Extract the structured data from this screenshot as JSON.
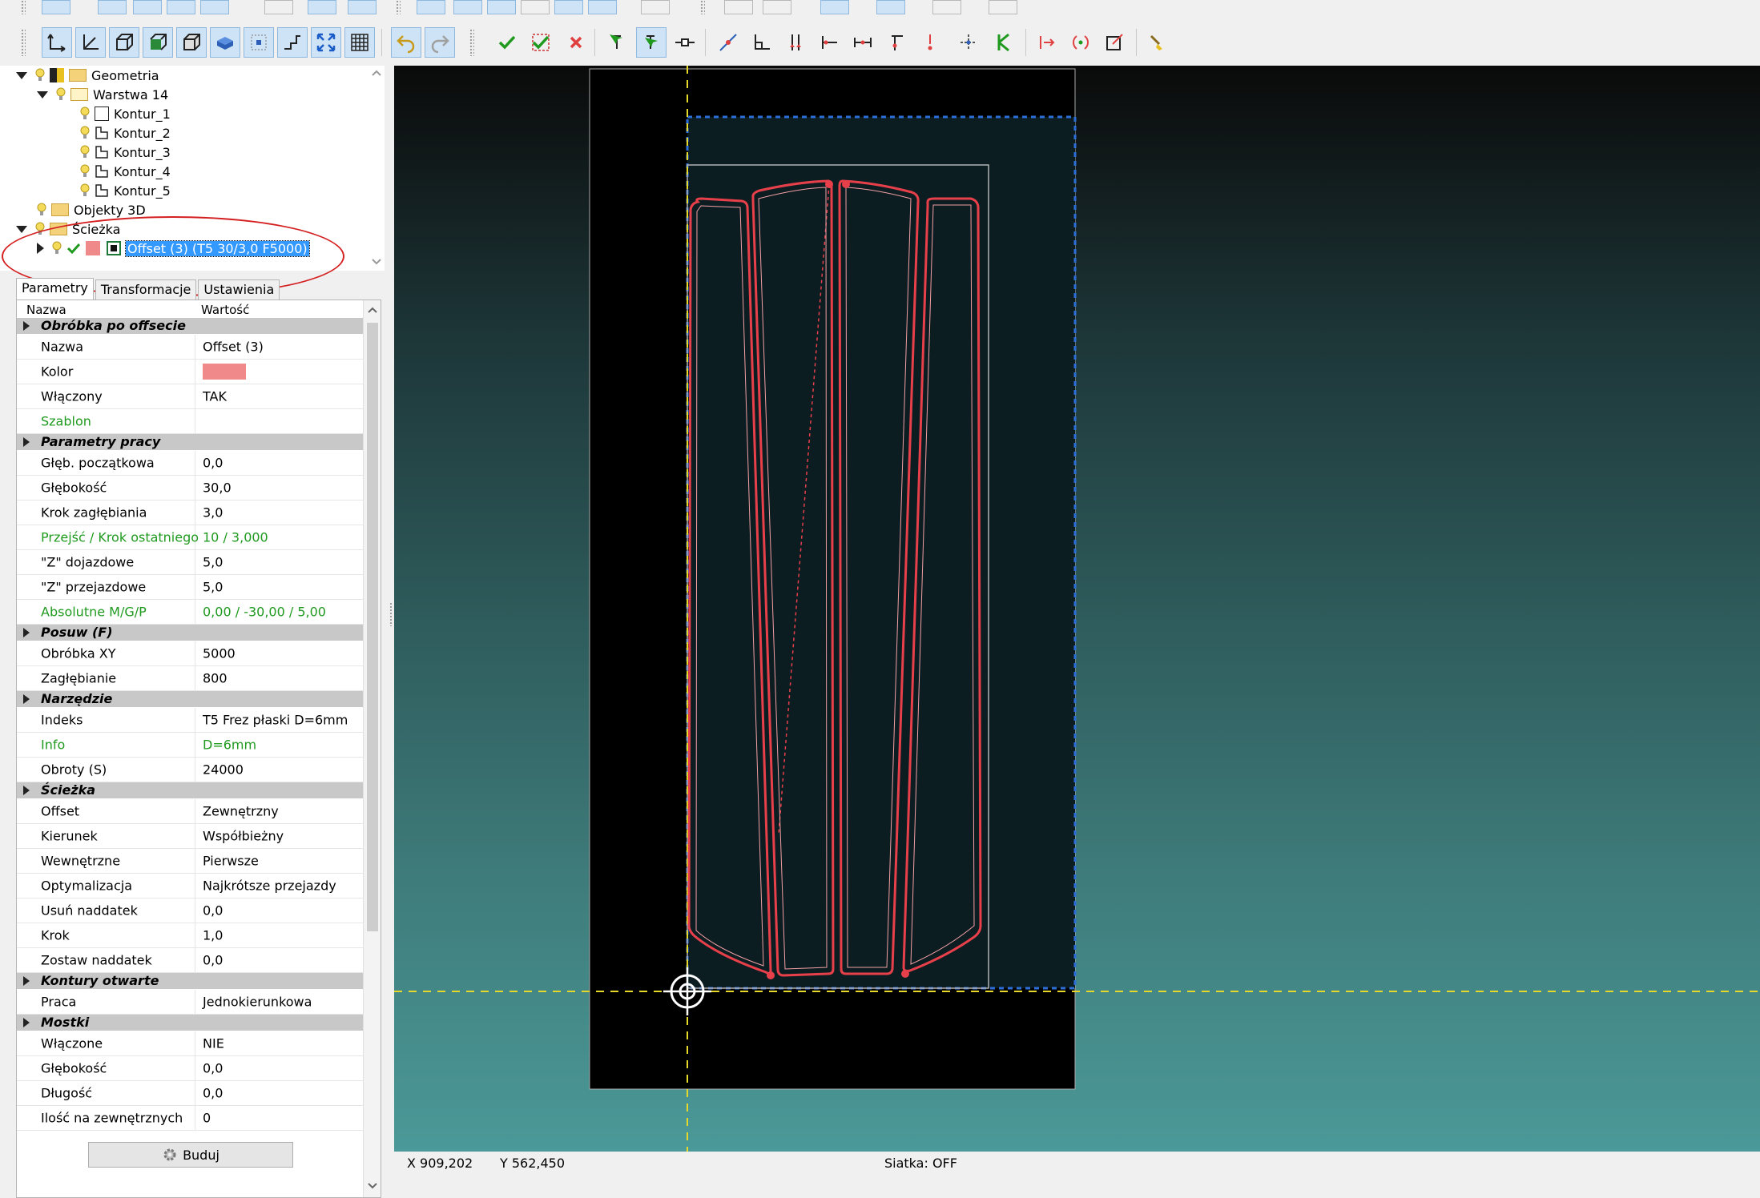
{
  "tree": {
    "items": [
      {
        "label": "Geometria"
      },
      {
        "label": "Warstwa 14"
      },
      {
        "label": "Kontur_1"
      },
      {
        "label": "Kontur_2"
      },
      {
        "label": "Kontur_3"
      },
      {
        "label": "Kontur_4"
      },
      {
        "label": "Kontur_5"
      },
      {
        "label": "Objekty 3D"
      },
      {
        "label": "Ścieżka"
      },
      {
        "label": "Offset (3) (T5 30/3,0 F5000)"
      }
    ]
  },
  "tabs": [
    "Parametry",
    "Transformacje",
    "Ustawienia"
  ],
  "grid": {
    "header": {
      "name": "Nazwa",
      "value": "Wartość"
    },
    "sections": [
      {
        "title": "Obróbka po offsecie",
        "rows": [
          {
            "name": "Nazwa",
            "value": "Offset (3)"
          },
          {
            "name": "Kolor",
            "value": "",
            "color": "#f08a8a"
          },
          {
            "name": "Włączony",
            "value": "TAK"
          },
          {
            "name": "Szablon",
            "value": "",
            "green": true
          }
        ]
      },
      {
        "title": "Parametry pracy",
        "rows": [
          {
            "name": "Głęb. początkowa",
            "value": "0,0"
          },
          {
            "name": "Głębokość",
            "value": "30,0"
          },
          {
            "name": "Krok zagłębiania",
            "value": "3,0"
          },
          {
            "name": "Przejść / Krok ostatniego",
            "value": "10 / 3,000",
            "green": true
          },
          {
            "name": "\"Z\" dojazdowe",
            "value": "5,0"
          },
          {
            "name": "\"Z\" przejazdowe",
            "value": "5,0"
          },
          {
            "name": "Absolutne M/G/P",
            "value": "0,00 / -30,00 / 5,00",
            "green": true
          }
        ]
      },
      {
        "title": "Posuw (F)",
        "rows": [
          {
            "name": "Obróbka XY",
            "value": "5000"
          },
          {
            "name": "Zagłębianie",
            "value": "800"
          }
        ]
      },
      {
        "title": "Narzędzie",
        "rows": [
          {
            "name": "Indeks",
            "value": "T5 Frez płaski D=6mm"
          },
          {
            "name": "Info",
            "value": "D=6mm",
            "green": true
          },
          {
            "name": "Obroty (S)",
            "value": "24000"
          }
        ]
      },
      {
        "title": "Ścieżka",
        "rows": [
          {
            "name": "Offset",
            "value": "Zewnętrzny"
          },
          {
            "name": "Kierunek",
            "value": "Współbieżny"
          },
          {
            "name": "Wewnętrzne",
            "value": "Pierwsze"
          },
          {
            "name": "Optymalizacja",
            "value": "Najkrótsze przejazdy"
          },
          {
            "name": "Usuń naddatek",
            "value": "0,0"
          },
          {
            "name": "Krok",
            "value": "1,0"
          },
          {
            "name": "Zostaw naddatek",
            "value": "0,0"
          }
        ]
      },
      {
        "title": "Kontury otwarte",
        "rows": [
          {
            "name": "Praca",
            "value": "Jednokierunkowa"
          }
        ]
      },
      {
        "title": "Mostki",
        "rows": [
          {
            "name": "Włączone",
            "value": "NIE"
          },
          {
            "name": "Głębokość",
            "value": "0,0"
          },
          {
            "name": "Długość",
            "value": "0,0"
          },
          {
            "name": "Ilość na zewnętrznych",
            "value": "0"
          }
        ]
      }
    ]
  },
  "build_button": {
    "label": "Buduj"
  },
  "status": {
    "x": "X 909,202",
    "y": "Y 562,450",
    "grid": "Siatka: OFF"
  },
  "colors": {
    "path": "#e8404a",
    "selection": "#3399ff",
    "swatch": "#f08a8a"
  }
}
